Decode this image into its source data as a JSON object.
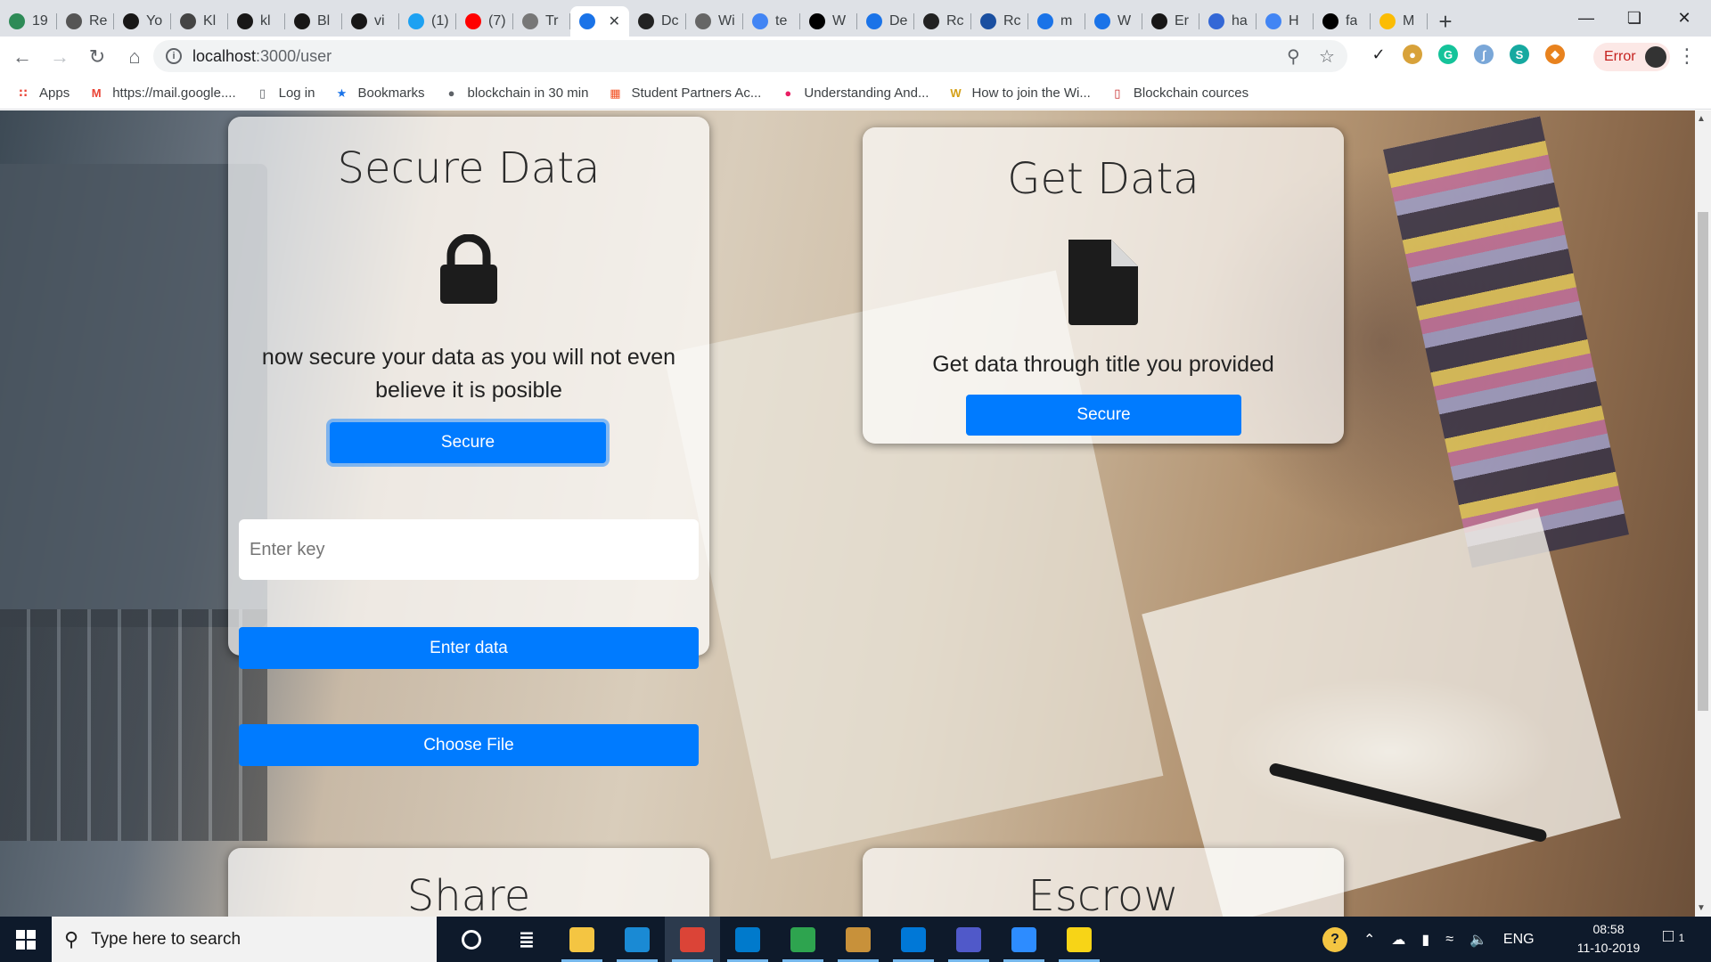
{
  "tabs": [
    {
      "title": "19",
      "icon": "globe-icon",
      "color": "#2e8b57"
    },
    {
      "title": "Re",
      "icon": "arrow-icon",
      "color": "#555555"
    },
    {
      "title": "Yo",
      "icon": "github-icon",
      "color": "#181717"
    },
    {
      "title": "Kl",
      "icon": "globe-icon",
      "color": "#444444"
    },
    {
      "title": "kl",
      "icon": "github-icon",
      "color": "#181717"
    },
    {
      "title": "Bl",
      "icon": "github-icon",
      "color": "#181717"
    },
    {
      "title": "vi",
      "icon": "github-icon",
      "color": "#181717"
    },
    {
      "title": "(1)",
      "icon": "twitter-icon",
      "color": "#1da1f2"
    },
    {
      "title": "(7)",
      "icon": "youtube-icon",
      "color": "#ff0000"
    },
    {
      "title": "Tr",
      "icon": "loading-icon",
      "color": "#777777"
    },
    {
      "title": "",
      "icon": "app-icon",
      "color": "#1a73e8",
      "active": true
    },
    {
      "title": "Dc",
      "icon": "globe-icon",
      "color": "#222222"
    },
    {
      "title": "Wi",
      "icon": "globe-icon",
      "color": "#666666"
    },
    {
      "title": "te",
      "icon": "google-icon",
      "color": "#4285f4"
    },
    {
      "title": "W",
      "icon": "medium-icon",
      "color": "#000000"
    },
    {
      "title": "De",
      "icon": "m-icon",
      "color": "#1a73e8"
    },
    {
      "title": "Rc",
      "icon": "tool-icon",
      "color": "#222222"
    },
    {
      "title": "Rc",
      "icon": "globe-icon",
      "color": "#1a4fa0"
    },
    {
      "title": "m",
      "icon": "m-icon",
      "color": "#1a73e8"
    },
    {
      "title": "W",
      "icon": "m-icon",
      "color": "#1a73e8"
    },
    {
      "title": "Er",
      "icon": "github-icon",
      "color": "#181717"
    },
    {
      "title": "ha",
      "icon": "docs-icon",
      "color": "#3367d6"
    },
    {
      "title": "H",
      "icon": "docs-icon",
      "color": "#4285f4"
    },
    {
      "title": "fa",
      "icon": "image-icon",
      "color": "#000000"
    },
    {
      "title": "M",
      "icon": "drive-icon",
      "color": "#fbbc04"
    }
  ],
  "address": {
    "host": "localhost",
    "path": ":3000/user"
  },
  "profile": {
    "label": "Error"
  },
  "bookmarks": [
    {
      "label": "Apps",
      "icon": "apps-icon",
      "color": "#ea4335"
    },
    {
      "label": "https://mail.google....",
      "icon": "gmail-icon",
      "color": "#ea4335"
    },
    {
      "label": "Log in",
      "icon": "page-icon",
      "color": "#5f6368"
    },
    {
      "label": "Bookmarks",
      "icon": "star-icon",
      "color": "#1a73e8"
    },
    {
      "label": "blockchain in 30 min",
      "icon": "globe-icon",
      "color": "#5f6368"
    },
    {
      "label": "Student Partners Ac...",
      "icon": "microsoft-icon",
      "color": "#f25022"
    },
    {
      "label": "Understanding And...",
      "icon": "circle-icon",
      "color": "#e91e63"
    },
    {
      "label": "How to join the Wi...",
      "icon": "w-icon",
      "color": "#d4a017"
    },
    {
      "label": "Blockchain cources",
      "icon": "page-icon",
      "color": "#c62828"
    }
  ],
  "cards": {
    "secure": {
      "title": "Secure Data",
      "description": "now secure your data as you will not even believe it is posible",
      "button": "Secure",
      "key_placeholder": "Enter key",
      "enter_button": "Enter data",
      "file_button": "Choose File",
      "icon": "lock-icon"
    },
    "get": {
      "title": "Get Data",
      "description": "Get data through title you provided",
      "button": "Secure",
      "icon": "file-icon"
    },
    "share": {
      "title": "Share"
    },
    "escrow": {
      "title": "Escrow"
    }
  },
  "theme": {
    "primary": "#007bff"
  },
  "taskbar": {
    "search_placeholder": "Type here to search",
    "apps": [
      {
        "name": "cortana-icon"
      },
      {
        "name": "task-view-icon"
      },
      {
        "name": "file-explorer-icon",
        "color": "#f4c542"
      },
      {
        "name": "store-badge-icon",
        "color": "#1a8ad4"
      },
      {
        "name": "chrome-icon",
        "color": "#db4437",
        "active": true
      },
      {
        "name": "vscode-icon",
        "color": "#007acc"
      },
      {
        "name": "git-icon",
        "color": "#2ea44f"
      },
      {
        "name": "package-icon",
        "color": "#c8913a"
      },
      {
        "name": "microsoft-store-icon",
        "color": "#0078d7"
      },
      {
        "name": "teams-icon",
        "color": "#5059c9"
      },
      {
        "name": "zoom-icon",
        "color": "#2d8cff"
      },
      {
        "name": "sticky-icon",
        "color": "#f7d417"
      }
    ],
    "language": "ENG",
    "time": "08:58",
    "date": "11-10-2019",
    "notifications": "1"
  }
}
